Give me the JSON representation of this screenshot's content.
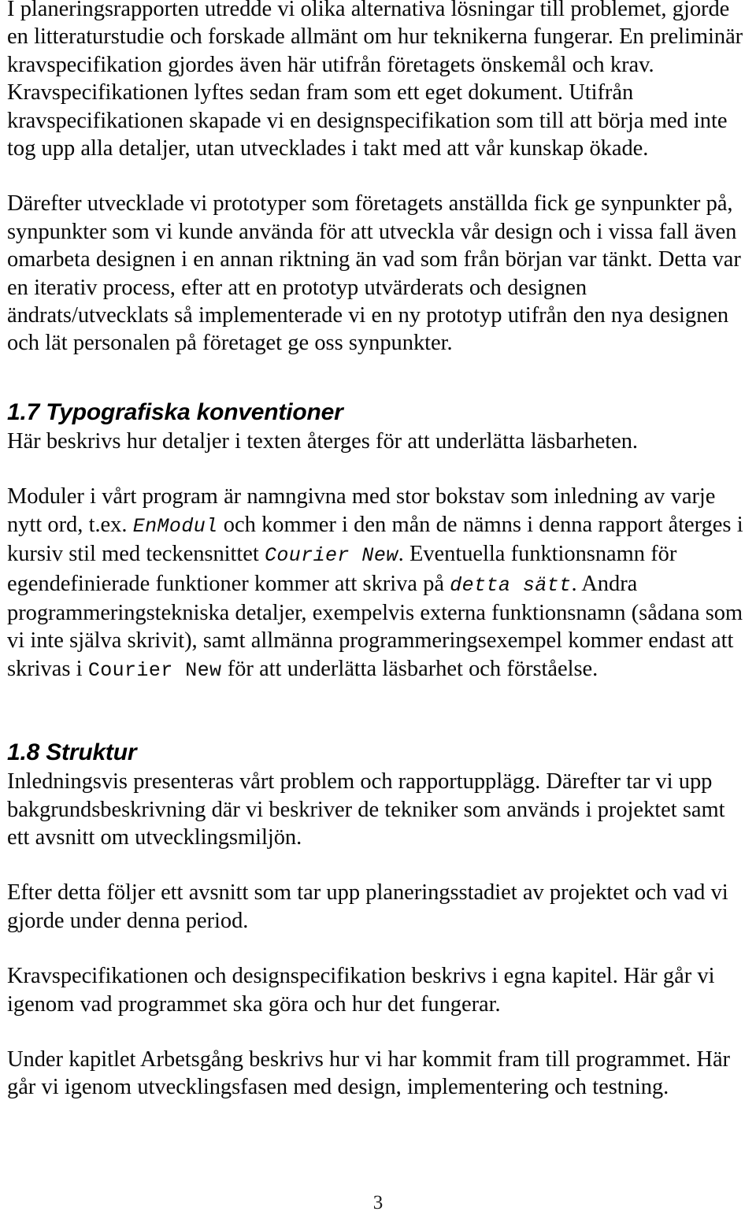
{
  "document": {
    "page_number": "3",
    "language": "sv"
  },
  "blocks": {
    "paragraph_1": "I planeringsrapporten utredde vi olika alternativa lösningar till problemet, gjorde en litteraturstudie och forskade allmänt om hur teknikerna fungerar. En preliminär kravspecifikation gjordes även här utifrån företagets önskemål och krav. Kravspecifikationen lyftes sedan fram som ett eget dokument. Utifrån kravspecifikationen skapade vi en designspecifikation som till att börja med inte tog upp alla detaljer, utan utvecklades i takt med att vår kunskap ökade.",
    "paragraph_2": "Därefter utvecklade vi prototyper som företagets anställda fick ge synpunkter på, synpunkter som vi kunde använda för att utveckla vår design och i vissa fall även omarbeta designen i en annan riktning än vad som från början var tänkt. Detta var en iterativ process, efter att en prototyp utvärderats och designen ändrats/utvecklats så implementerade vi en ny prototyp utifrån den nya designen och lät personalen på företaget ge oss synpunkter.",
    "heading_1_7": "1.7 Typografiska konventioner",
    "paragraph_3": "Här beskrivs hur detaljer i texten återges för att underlätta läsbarheten.",
    "paragraph_4": {
      "part_1": "Moduler i vårt program är namngivna med stor bokstav som inledning av varje nytt ord, t.ex. ",
      "code_1": "EnModul",
      "part_2": " och kommer i den mån de nämns i denna rapport återges i kursiv stil med teckensnittet ",
      "code_2": "Courier New",
      "part_3": ". Eventuella funktionsnamn för egendefinierade funktioner kommer att skriva på ",
      "code_3": "detta sätt",
      "part_4": ". Andra programmeringstekniska detaljer, exempelvis externa funktionsnamn (sådana som vi inte själva skrivit), samt allmänna programmeringsexempel kommer endast att skrivas i ",
      "code_4": "Courier New",
      "part_5": " för att underlätta läsbarhet och förståelse."
    },
    "heading_1_8": "1.8 Struktur",
    "paragraph_5": "Inledningsvis presenteras vårt problem och rapportupplägg. Därefter tar vi upp bakgrundsbeskrivning där vi beskriver de tekniker som används i projektet samt ett avsnitt om utvecklingsmiljön.",
    "paragraph_6": "Efter detta följer ett avsnitt som tar upp planeringsstadiet av projektet och vad vi gjorde under denna period.",
    "paragraph_7": "Kravspecifikationen och designspecifikation beskrivs i egna kapitel. Här går vi igenom vad programmet ska göra och hur det fungerar.",
    "paragraph_8": "Under kapitlet Arbetsgång beskrivs hur vi har kommit fram till programmet. Här går vi igenom utvecklingsfasen med design, implementering och testning."
  }
}
